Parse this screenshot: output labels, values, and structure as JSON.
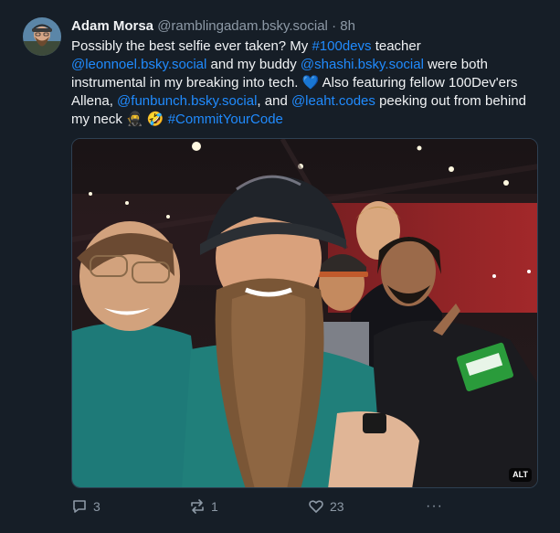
{
  "post": {
    "author": {
      "display_name": "Adam Morsa",
      "handle": "@ramblingadam.bsky.social",
      "separator": "·",
      "time": "8h"
    },
    "text": {
      "t1": "Possibly the best selfie ever taken? My ",
      "tag_100devs": "#100devs",
      "t2": " teacher ",
      "mention_leon": "@leonnoel.bsky.social",
      "t3": " and my buddy ",
      "mention_shashi": "@shashi.bsky.social",
      "t4": " were both instrumental in my breaking into tech. ",
      "heart": "💙",
      "t5": " Also featuring fellow 100Dev'ers Allena, ",
      "mention_funbunch": "@funbunch.bsky.social",
      "t6": ", and ",
      "mention_leaht": "@leaht.codes",
      "t7": " peeking out from behind my neck ",
      "emoji": "🥷 🤣",
      "t8": " ",
      "tag_commit": "#CommitYourCode"
    },
    "media": {
      "alt_label": "ALT"
    },
    "actions": {
      "reply_count": "3",
      "repost_count": "1",
      "like_count": "23",
      "more_label": "···"
    }
  },
  "icons": {
    "reply": "speech-bubble-icon",
    "repost": "repost-arrows-icon",
    "like": "heart-icon",
    "more": "ellipsis-icon"
  },
  "colors": {
    "background": "#161e27",
    "link": "#208bfe",
    "muted": "#8d99a6",
    "text": "#f1f3f5"
  }
}
